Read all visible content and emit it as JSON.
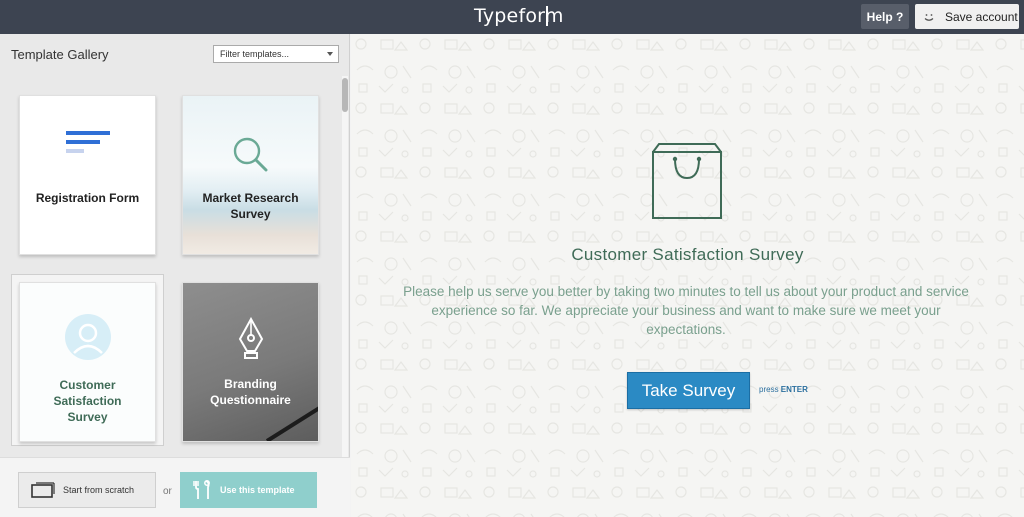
{
  "topbar": {
    "brand": "Typeform",
    "help_label": "Help ?",
    "save_label": "Save account"
  },
  "sidebar": {
    "title": "Template Gallery",
    "filter_value": "Filter templates...",
    "templates": [
      {
        "label_line1": "Registration Form",
        "label_line2": ""
      },
      {
        "label_line1": "Market Research",
        "label_line2": "Survey"
      },
      {
        "label_line1": "Customer",
        "label_line2": "Satisfaction",
        "label_line3": "Survey"
      },
      {
        "label_line1": "Branding",
        "label_line2": "Questionnaire"
      }
    ],
    "start_scratch_label": "Start from scratch",
    "or_label": "or",
    "use_template_label": "Use this template"
  },
  "preview": {
    "title": "Customer Satisfaction Survey",
    "description": "Please help us serve you better by taking two minutes to tell us about your product and service experience so far. We appreciate your business and want to make sure we meet your expectations.",
    "button_label": "Take Survey",
    "press_prefix": "press",
    "press_key": "ENTER"
  },
  "colors": {
    "topbar": "#3d4451",
    "accent": "#2b8ac4",
    "survey_green": "#3f6b57",
    "use_template": "#8fcfcc"
  }
}
